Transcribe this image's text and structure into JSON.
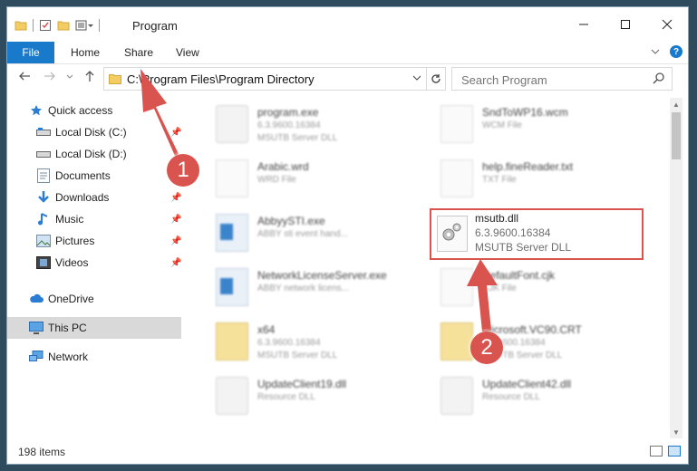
{
  "window": {
    "title": "Program"
  },
  "ribbon": {
    "tabs": [
      "File",
      "Home",
      "Share",
      "View"
    ]
  },
  "navigation": {
    "address_path": "C:\\Program Files\\Program Directory",
    "search_placeholder": "Search Program"
  },
  "sidebar": {
    "quick_access": "Quick access",
    "items": [
      {
        "label": "Local Disk (C:)",
        "icon": "drive-icon",
        "pinned": true
      },
      {
        "label": "Local Disk (D:)",
        "icon": "drive-icon",
        "pinned": false
      },
      {
        "label": "Documents",
        "icon": "documents-icon",
        "pinned": true
      },
      {
        "label": "Downloads",
        "icon": "downloads-icon",
        "pinned": true
      },
      {
        "label": "Music",
        "icon": "music-icon",
        "pinned": true
      },
      {
        "label": "Pictures",
        "icon": "pictures-icon",
        "pinned": true
      },
      {
        "label": "Videos",
        "icon": "videos-icon",
        "pinned": true
      }
    ],
    "onedrive": "OneDrive",
    "this_pc": "This PC",
    "network": "Network"
  },
  "files": {
    "left_column": [
      {
        "name": "program.exe",
        "type": "6.3.9600.16384",
        "desc": "MSUTB Server DLL",
        "kind": "gear"
      },
      {
        "name": "Arabic.wrd",
        "type": "WRD File",
        "desc": "",
        "kind": "doc"
      },
      {
        "name": "AbbyySTI.exe",
        "type": "ABBY sti event hand...",
        "desc": "",
        "kind": "exe"
      },
      {
        "name": "NetworkLicenseServer.exe",
        "type": "ABBY network licens...",
        "desc": "",
        "kind": "exe"
      },
      {
        "name": "x64",
        "type": "6.3.9600.16384",
        "desc": "MSUTB Server DLL",
        "kind": "fold"
      },
      {
        "name": "UpdateClient19.dll",
        "type": "Resource DLL",
        "desc": "",
        "kind": "gear"
      }
    ],
    "right_column": [
      {
        "name": "SndToWP16.wcm",
        "type": "WCM File",
        "desc": "",
        "kind": "doc"
      },
      {
        "name": "help.fineReader.txt",
        "type": "TXT File",
        "desc": "",
        "kind": "doc"
      },
      {
        "name": "DefaultFont.cjk",
        "type": "CJK File",
        "desc": "",
        "kind": "doc"
      },
      {
        "name": "Microsoft.VC90.CRT",
        "type": "6.3.9600.16384",
        "desc": "MSUTB Server DLL",
        "kind": "fold"
      },
      {
        "name": "UpdateClient42.dll",
        "type": "Resource DLL",
        "desc": "",
        "kind": "gear"
      }
    ],
    "highlighted": {
      "name": "msutb.dll",
      "version": "6.3.9600.16384",
      "description": "MSUTB Server DLL"
    }
  },
  "status": {
    "item_count": "198 items"
  },
  "annotations": {
    "step1": "1",
    "step2": "2",
    "color": "#d9534f"
  },
  "colors": {
    "accent": "#1979ca",
    "selected_bg": "#d9d9d9"
  }
}
